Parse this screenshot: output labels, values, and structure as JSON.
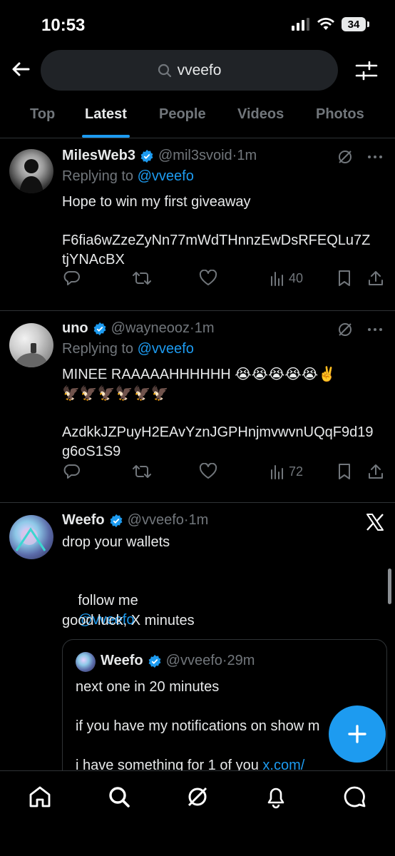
{
  "status_bar": {
    "time": "10:53",
    "battery": "34"
  },
  "search": {
    "query": "vveefo"
  },
  "tabs": [
    "Top",
    "Latest",
    "People",
    "Videos",
    "Photos"
  ],
  "active_tab": "Latest",
  "tweets": [
    {
      "name": "MilesWeb3",
      "handle": "@mil3svoid",
      "time": "1m",
      "replying_to_label": "Replying to",
      "replying_to": "@vveefo",
      "text": "Hope to win my first giveaway\n\nF6fia6wZzeZyNn77mWdTHnnzEwDsRFEQLu7Z\ntjYNAcBX",
      "views": "40"
    },
    {
      "name": "uno",
      "handle": "@wayneooz",
      "time": "1m",
      "replying_to_label": "Replying to",
      "replying_to": "@vveefo",
      "text": "MINEE RAAAAAHHHHHH 😭😭😭😭😭✌️\n🦅🦅🦅🦅🦅🦅\n\nAzdkkJZPuyH2EAvYznJGPHnjmvwvnUQqF9d19\ng6oS1S9",
      "views": "72"
    },
    {
      "name": "Weefo",
      "handle": "@vveefo",
      "time": "1m",
      "text_line1": "drop your wallets",
      "text_follow": "follow me",
      "text_follow_link": "@vveefo",
      "text_line3": "good luck, X minutes",
      "quote": {
        "name": "Weefo",
        "handle": "@vveefo",
        "time": "29m",
        "line1": "next one in 20 minutes",
        "line2": "if you have my notifications on show m",
        "line3": "i have something for 1 of you",
        "line3_link": "x.com/"
      }
    }
  ],
  "colors": {
    "accent": "#1d9bf0",
    "muted": "#71767b",
    "background": "#000000",
    "divider": "#2f3336"
  },
  "icons": [
    "back-arrow-icon",
    "search-icon",
    "filter-icon",
    "grok-icon",
    "more-icon",
    "reply-icon",
    "retweet-icon",
    "like-icon",
    "views-icon",
    "bookmark-icon",
    "share-icon",
    "x-logo-icon",
    "compose-icon",
    "home-icon",
    "explore-icon",
    "notifications-icon",
    "messages-icon"
  ]
}
